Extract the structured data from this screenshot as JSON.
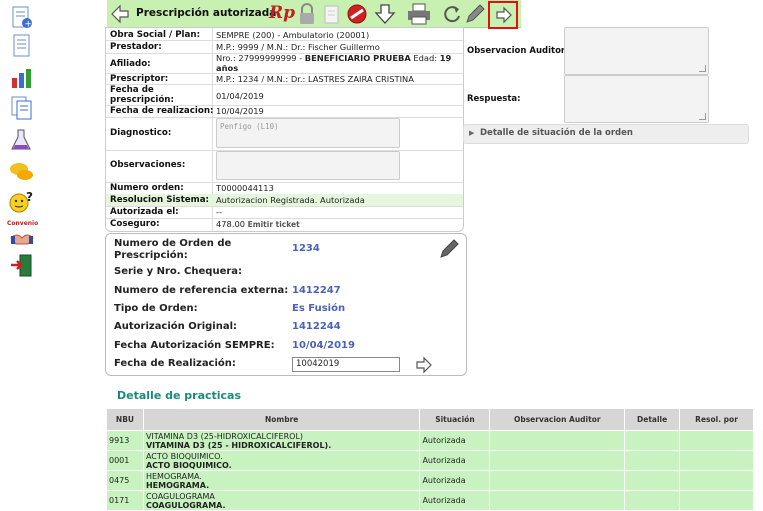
{
  "toolbar": {
    "title": "Prescripción autorizada.",
    "rp_label": "Rp"
  },
  "info": {
    "obra_social_label": "Obra Social / Plan:",
    "obra_social_value": "SEMPRE (200) - Ambulatorio (20001)",
    "prestador_label": "Prestador:",
    "prestador_value": "M.P.: 9999 / M.N.: Dr.: Fischer Guillermo",
    "afiliado_label": "Afiliado:",
    "afiliado_value_prefix": "Nro.: 27999999999 - ",
    "afiliado_value_name": "BENEFICIARIO PRUEBA",
    "afiliado_value_edad": " Edad: ",
    "afiliado_value_age": "19",
    "afiliado_value_years": "años",
    "prescriptor_label": "Prescriptor:",
    "prescriptor_value": "M.P.: 1234 / M.N.: Dr.: LASTRES ZAIRA CRISTINA",
    "fecha_prescripcion_label_1": "Fecha de",
    "fecha_prescripcion_label_2": "prescripción:",
    "fecha_prescripcion_value": "01/04/2019",
    "fecha_realizacion_label": "Fecha de realizacion:",
    "fecha_realizacion_value": "10/04/2019",
    "diagnostico_label": "Diagnostico:",
    "diagnostico_value": "Penfigo (L10)",
    "observaciones_label": "Observaciones:",
    "numero_orden_label": "Numero orden:",
    "numero_orden_value": "T0000044113",
    "resolucion_label": "Resolucion Sistema:",
    "resolucion_value": "Autorizacion Registrada. Autorizada",
    "autorizada_el_label": "Autorizada el:",
    "autorizada_el_value": "--",
    "coseguro_label": "Coseguro:",
    "coseguro_value": "478.00",
    "emitir_ticket": "Emitir ticket"
  },
  "right": {
    "observacion_auditor_label": "Observacion Auditor",
    "respuesta_label": "Respuesta:",
    "detalle_situacion": "Detalle de situación de la orden"
  },
  "order": {
    "numero_orden_presc_label_1": "Numero de Orden de",
    "numero_orden_presc_label_2": "Prescripción:",
    "numero_orden_presc_value": "1234",
    "serie_label": "Serie y Nro. Chequera:",
    "referencia_label": "Numero de referencia externa:",
    "referencia_value": "1412247",
    "tipo_label": "Tipo de Orden:",
    "tipo_value": "Es Fusión",
    "autorizacion_label": "Autorización Original:",
    "autorizacion_value": "1412244",
    "fecha_aut_label": "Fecha Autorización SEMPRE:",
    "fecha_aut_value": "10/04/2019",
    "fecha_real_label": "Fecha de Realización:",
    "fecha_real_input": "10042019"
  },
  "practicas": {
    "title": "Detalle de practicas",
    "headers": [
      "NBU",
      "Nombre",
      "Situación",
      "Observacion Auditor",
      "Detalle",
      "Resol. por"
    ],
    "rows": [
      {
        "nbu": "9913",
        "nombre1": "VITAMINA D3 (25-HIDROXICALCIFEROL)",
        "nombre2": "VITAMINA D3 (25 - HIDROXICALCIFEROL).",
        "situacion": "Autorizada"
      },
      {
        "nbu": "0001",
        "nombre1": "ACTO BIOQUIMICO.",
        "nombre2": "ACTO BIOQUIMICO.",
        "situacion": "Autorizada"
      },
      {
        "nbu": "0475",
        "nombre1": "HEMOGRAMA.",
        "nombre2": "HEMOGRAMA.",
        "situacion": "Autorizada"
      },
      {
        "nbu": "0171",
        "nombre1": "COAGULOGRAMA",
        "nombre2": "COAGULOGRAMA.",
        "situacion": "Autorizada"
      }
    ]
  },
  "sidebar": {
    "convenio_label": "Convenio"
  },
  "colors": {
    "toolbar_bg": "#c8f0b0",
    "row_green": "#c8f3c0",
    "value_blue": "#4a62b8",
    "title_teal": "#1a8a7a",
    "highlight_red": "#e01010"
  }
}
